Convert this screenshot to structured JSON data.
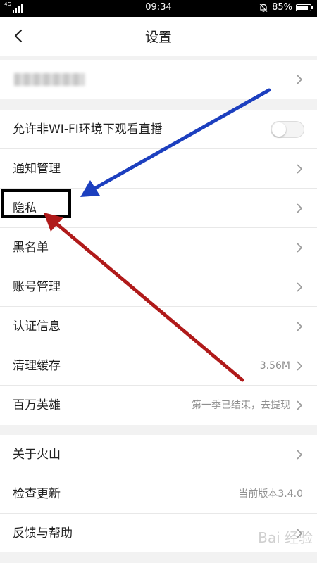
{
  "status_bar": {
    "network": "4G",
    "time": "09:34",
    "battery": "85%",
    "battery_fraction": 0.85
  },
  "header": {
    "title": "设置"
  },
  "sections": [
    {
      "rows": [
        {
          "label": "",
          "masked": true,
          "value": ""
        }
      ]
    },
    {
      "rows": [
        {
          "label": "允许非WI-FI环境下观看直播",
          "toggle": true,
          "toggle_on": false
        },
        {
          "label": "通知管理",
          "value": ""
        },
        {
          "label": "隐私",
          "value": ""
        },
        {
          "label": "黑名单",
          "value": ""
        },
        {
          "label": "账号管理",
          "value": ""
        },
        {
          "label": "认证信息",
          "value": ""
        },
        {
          "label": "清理缓存",
          "value": "3.56M"
        },
        {
          "label": "百万英雄",
          "value": "第一季已结束，去提现"
        }
      ]
    },
    {
      "rows": [
        {
          "label": "关于火山",
          "value": ""
        },
        {
          "label": "检查更新",
          "value": "当前版本3.4.0",
          "no_chevron": true
        },
        {
          "label": "反馈与帮助",
          "value": ""
        }
      ]
    }
  ],
  "annotations": {
    "box_color": "#000000",
    "arrow_blue": "#1c3fbf",
    "arrow_red": "#b01a1a"
  },
  "watermark": "Bai 经验",
  "colors": {
    "background": "#f2f2f2",
    "row_background": "#ffffff",
    "value_text": "#8f8f8f"
  }
}
